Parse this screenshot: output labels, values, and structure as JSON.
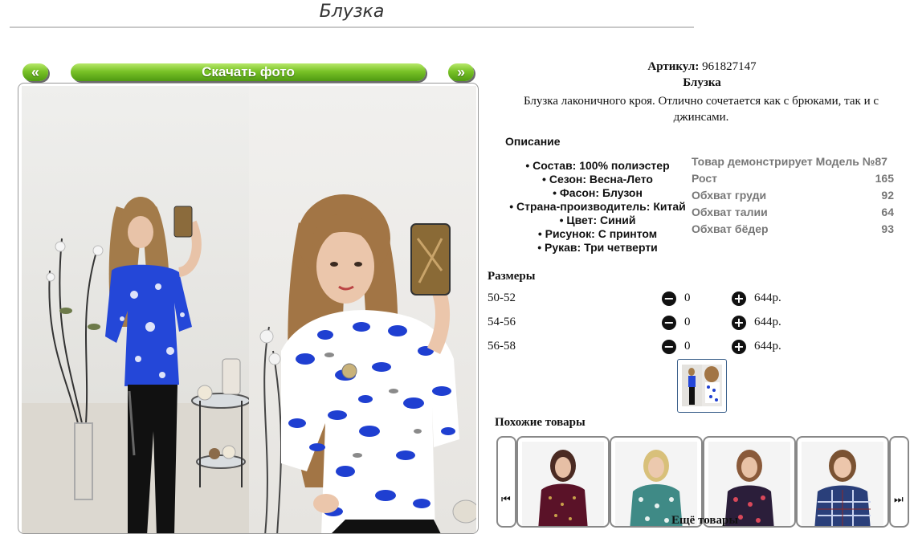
{
  "page": {
    "title": "Блузка"
  },
  "gallery": {
    "prev_label": "«",
    "download_label": "Скачать фото",
    "next_label": "»"
  },
  "product": {
    "sku_label": "Артикул:",
    "sku_value": "961827147",
    "name": "Блузка",
    "description": "Блузка лаконичного кроя. Отлично сочетается как с брюками, так и с джинсами.",
    "attributes_heading": "Описание",
    "attributes": [
      "Состав: 100% полиэстер",
      "Сезон: Весна-Лето",
      "Фасон: Блузон",
      "Страна-производитель: Китай",
      "Цвет: Синий",
      "Рисунок: С принтом",
      "Рукав: Три четверти"
    ]
  },
  "model": {
    "heading": "Товар демонстрирует Модель №87",
    "rows": [
      {
        "label": "Рост",
        "value": "165"
      },
      {
        "label": "Обхват груди",
        "value": "92"
      },
      {
        "label": "Обхват талии",
        "value": "64"
      },
      {
        "label": "Обхват бёдер",
        "value": "93"
      }
    ]
  },
  "sizes": {
    "heading": "Размеры",
    "minus_symbol": "−",
    "plus_symbol": "+",
    "rows": [
      {
        "size": "50-52",
        "qty": "0",
        "price": "644р."
      },
      {
        "size": "54-56",
        "qty": "0",
        "price": "644р."
      },
      {
        "size": "56-58",
        "qty": "0",
        "price": "644р."
      }
    ]
  },
  "similar": {
    "heading": "Похожие товары",
    "prev_arrow": "⏮",
    "next_arrow": "⏭",
    "more_label": "Ещё товары"
  },
  "colors": {
    "button_green": "#79c227",
    "print_blue": "#1f3fd1",
    "muted_text": "#777777"
  }
}
